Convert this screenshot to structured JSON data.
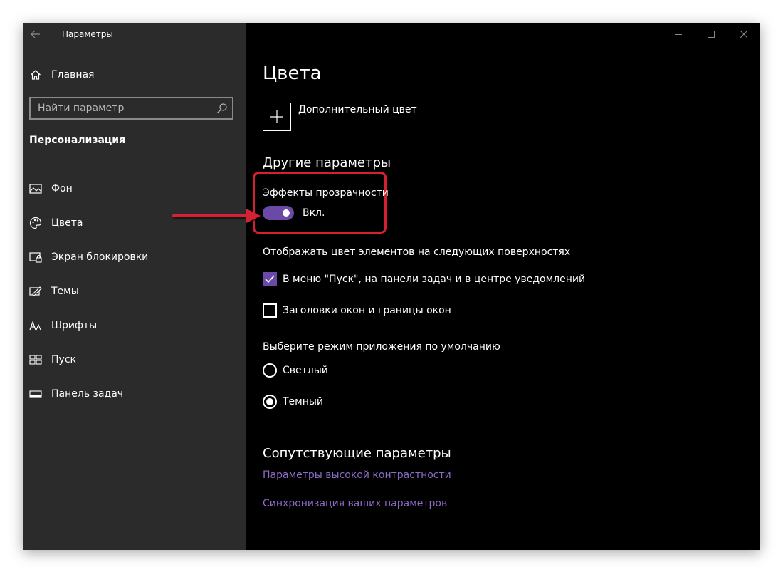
{
  "window": {
    "title": "Параметры"
  },
  "sidebar": {
    "home_label": "Главная",
    "search_placeholder": "Найти параметр",
    "section_title": "Персонализация",
    "items": [
      {
        "label": "Фон",
        "icon": "picture-icon"
      },
      {
        "label": "Цвета",
        "icon": "palette-icon"
      },
      {
        "label": "Экран блокировки",
        "icon": "lock-screen-icon"
      },
      {
        "label": "Темы",
        "icon": "themes-icon"
      },
      {
        "label": "Шрифты",
        "icon": "fonts-icon"
      },
      {
        "label": "Пуск",
        "icon": "start-icon"
      },
      {
        "label": "Панель задач",
        "icon": "taskbar-icon"
      }
    ]
  },
  "main": {
    "title": "Цвета",
    "add_color_label": "Дополнительный цвет",
    "other_params_title": "Другие параметры",
    "transparency_label": "Эффекты прозрачности",
    "transparency_state": "Вкл.",
    "transparency_on": true,
    "surfaces_label": "Отображать цвет элементов на следующих поверхностях",
    "checkbox_start": {
      "label": "В меню \"Пуск\", на панели задач и в центре уведомлений",
      "checked": true
    },
    "checkbox_titlebars": {
      "label": "Заголовки окон и границы окон",
      "checked": false
    },
    "mode_label": "Выберите режим приложения по умолчанию",
    "radio_light": {
      "label": "Светлый",
      "selected": false
    },
    "radio_dark": {
      "label": "Темный",
      "selected": true
    },
    "related_title": "Сопутствующие параметры",
    "link_contrast": "Параметры высокой контрастности",
    "link_sync": "Синхронизация ваших параметров"
  },
  "colors": {
    "accent": "#6b49a6",
    "link": "#8e6bc8",
    "annotation": "#d42030",
    "sidebar_bg": "#2b2b2b",
    "content_bg": "#000000"
  }
}
